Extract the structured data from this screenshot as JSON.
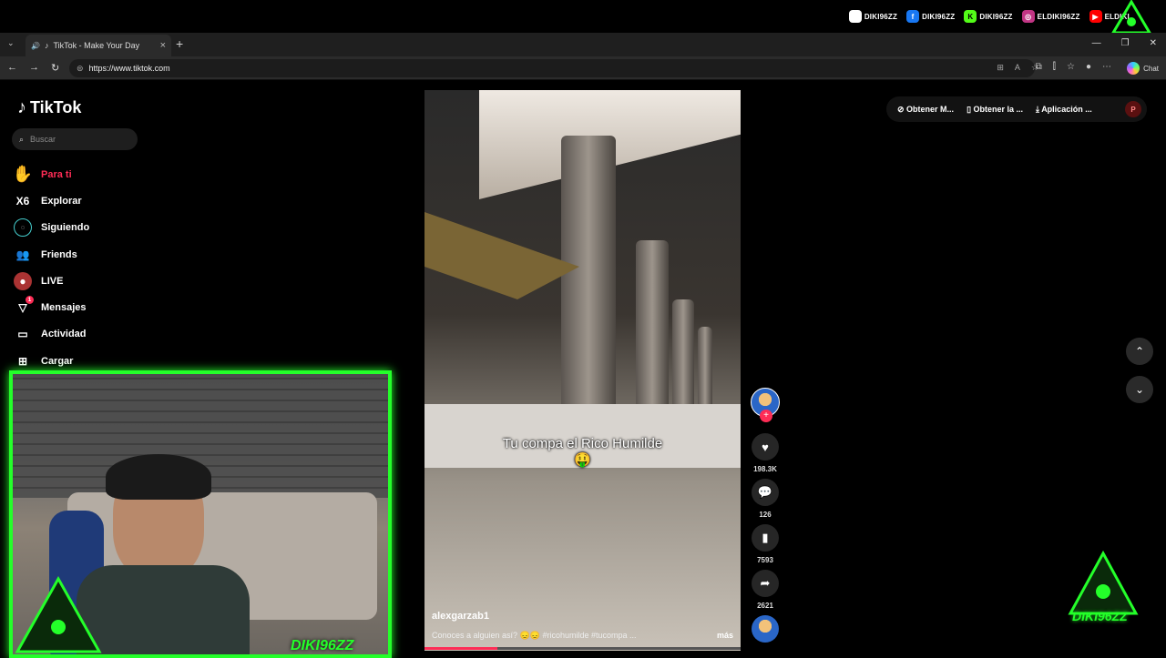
{
  "stream_overlay": {
    "socials": [
      {
        "icon": "tiktok-icon",
        "handle": "DIKI96ZZ",
        "color": "#ffffff"
      },
      {
        "icon": "facebook-icon",
        "handle": "DIKI96ZZ",
        "color": "#1877f2"
      },
      {
        "icon": "kick-icon",
        "handle": "DIKI96ZZ",
        "color": "#53fc18"
      },
      {
        "icon": "instagram-icon",
        "handle": "ELDIKI96ZZ",
        "color": "#c13584"
      },
      {
        "icon": "youtube-icon",
        "handle": "ELDIKI",
        "color": "#ff0000"
      }
    ],
    "webcam_tag": "DIKI96ZZ",
    "brand_text": "DIKI96ZZ"
  },
  "browser": {
    "tab_title": "TikTok - Make Your Day",
    "url": "https://www.tiktok.com",
    "chat_label": "Chat"
  },
  "tiktok": {
    "logo": "TikTok",
    "search_placeholder": "Buscar",
    "nav": [
      {
        "label": "Para ti",
        "icon": "home-icon",
        "active": true
      },
      {
        "label": "Explorar",
        "icon": "compass-icon"
      },
      {
        "label": "Siguiendo",
        "icon": "following-icon"
      },
      {
        "label": "Friends",
        "icon": "friends-icon"
      },
      {
        "label": "LIVE",
        "icon": "live-icon"
      },
      {
        "label": "Mensajes",
        "icon": "messages-icon",
        "badge": "1"
      },
      {
        "label": "Actividad",
        "icon": "activity-icon"
      },
      {
        "label": "Cargar",
        "icon": "upload-icon"
      }
    ],
    "top_actions": {
      "coins": "Obtener M...",
      "app": "Obtener la ...",
      "download": "Aplicación ...",
      "profile_initial": "P"
    },
    "video": {
      "caption": "Tu compa el Rico Humilde",
      "caption_emoji": "🤑",
      "author": "alexgarzab1",
      "description": "Conoces a alguien así? 😞😞 #ricohumilde #tucompa ...",
      "more": "más",
      "progress": 0.23
    },
    "actions": {
      "likes": "198.3K",
      "comments": "126",
      "saves": "7593",
      "shares": "2621"
    }
  }
}
